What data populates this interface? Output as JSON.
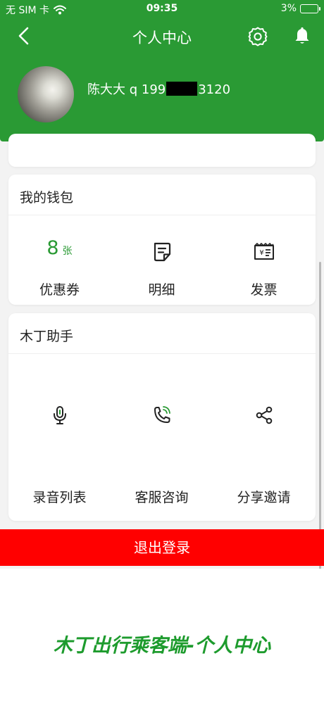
{
  "status_bar": {
    "carrier": "无 SIM 卡",
    "time": "09:35",
    "battery": "3%"
  },
  "header": {
    "title": "个人中心",
    "user_name_prefix": "陈大大 q 199",
    "user_name_suffix": "3120"
  },
  "wallet": {
    "title": "我的钱包",
    "items": [
      {
        "label": "优惠券",
        "value": "8",
        "unit": "张"
      },
      {
        "label": "明细",
        "icon": "document-icon"
      },
      {
        "label": "发票",
        "icon": "invoice-icon"
      }
    ]
  },
  "assistant": {
    "title": "木丁助手",
    "items": [
      {
        "label": "录音列表",
        "icon": "microphone-icon"
      },
      {
        "label": "客服咨询",
        "icon": "phone-call-icon"
      },
      {
        "label": "分享邀请",
        "icon": "share-icon"
      }
    ]
  },
  "logout_label": "退出登录",
  "caption": "木丁出行乘客端-个人中心",
  "colors": {
    "brand_green": "#2a9a34",
    "logout_red": "#ff0000"
  }
}
